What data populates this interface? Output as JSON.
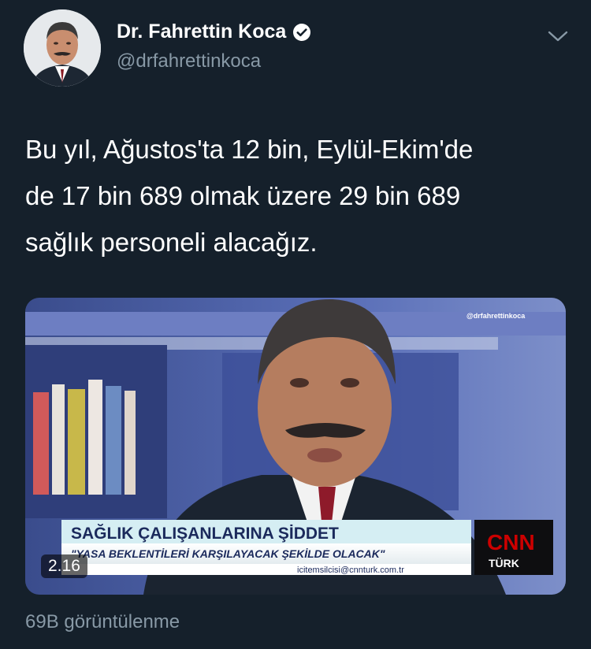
{
  "tweet": {
    "author_name": "Dr. Fahrettin Koca",
    "handle": "@drfahrettinkoca",
    "text": "Bu yıl, Ağustos'ta 12 bin, Eylül-Ekim'de\nde 17 bin 689 olmak üzere 29 bin 689\nsağlık personeli alacağız.",
    "views": "69B görüntülenme"
  },
  "video": {
    "duration": "2.16",
    "watermark": "@drfahrettinkoca",
    "headline": "SAĞLIK ÇALIŞANLARINA ŞİDDET",
    "subheadline": "\"YASA BEKLENTİLERİ KARŞILAYACAK ŞEKİLDE OLACAK\"",
    "ticker": "icitemsilcisi@cnnturk.com.tr",
    "channel_logo": "CNN",
    "channel_sub": "TÜRK"
  },
  "icons": {
    "verified": "verified-badge-icon",
    "caret": "chevron-down-icon",
    "play": "video-thumbnail"
  },
  "colors": {
    "background": "#15202b",
    "text": "#ffffff",
    "secondary": "#8899a6",
    "cnn_red": "#cc0000"
  }
}
